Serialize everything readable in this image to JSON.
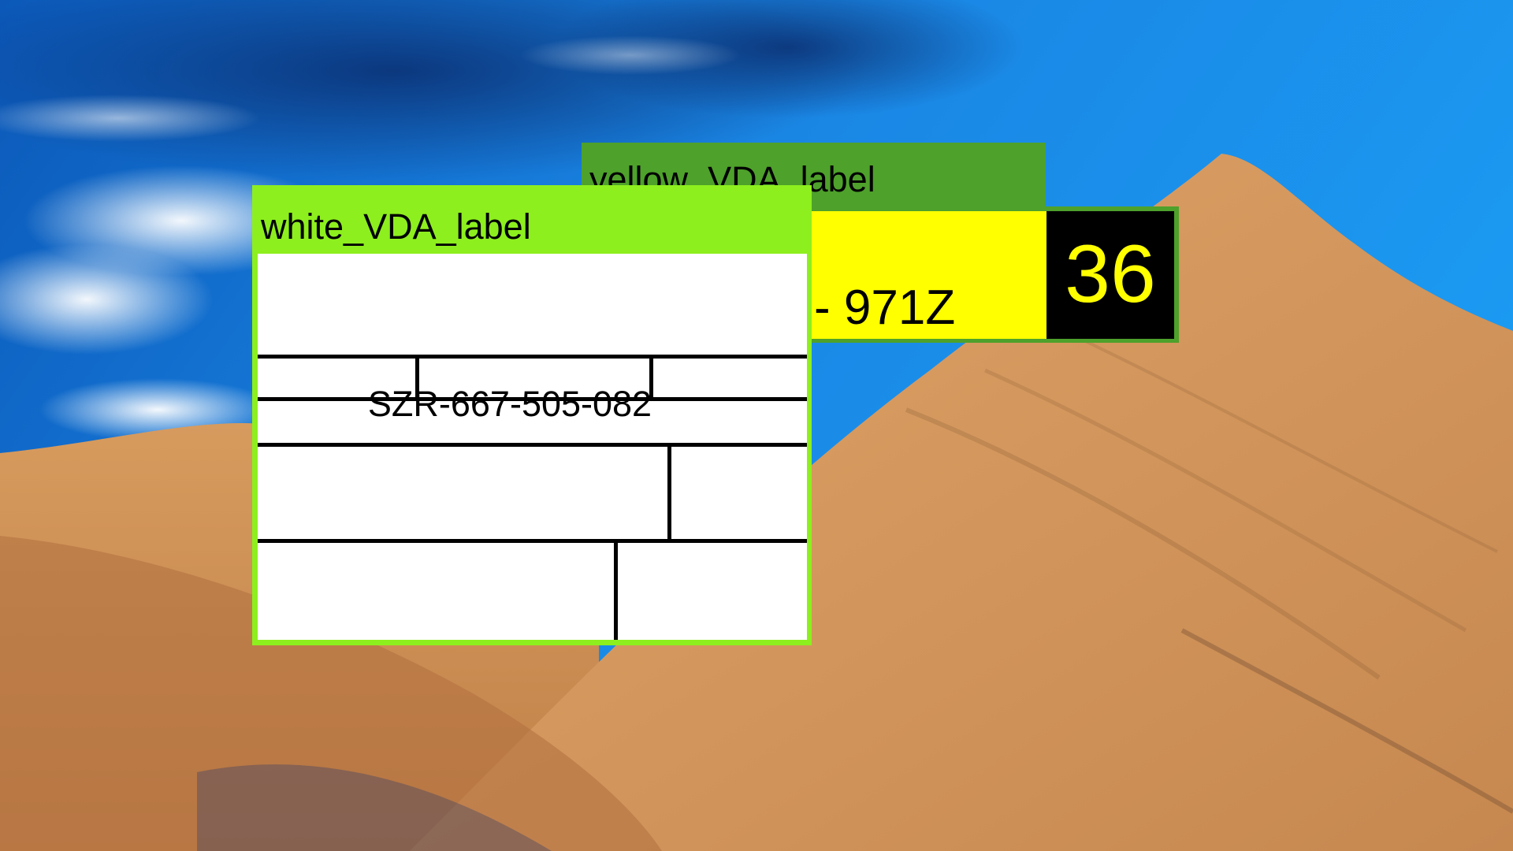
{
  "desktop": {
    "wallpaper": "desert-dunes-under-blue-sky",
    "colors": {
      "sky": "#1a8ae8",
      "sand": "#d3965a",
      "sand_shadow": "#9c6a3f"
    }
  },
  "windows": {
    "yellow": {
      "title": "yellow_VDA_label",
      "code": "- 971Z",
      "number": "36",
      "colors": {
        "frame": "#4ea12b",
        "field": "#ffff00",
        "number_box": "#000000",
        "number_text": "#ffff00"
      }
    },
    "white": {
      "title": "white_VDA_label",
      "serial": "SZR-667-505-082",
      "colors": {
        "frame": "#8def1e",
        "form": "#ffffff",
        "lines": "#000000"
      }
    }
  }
}
